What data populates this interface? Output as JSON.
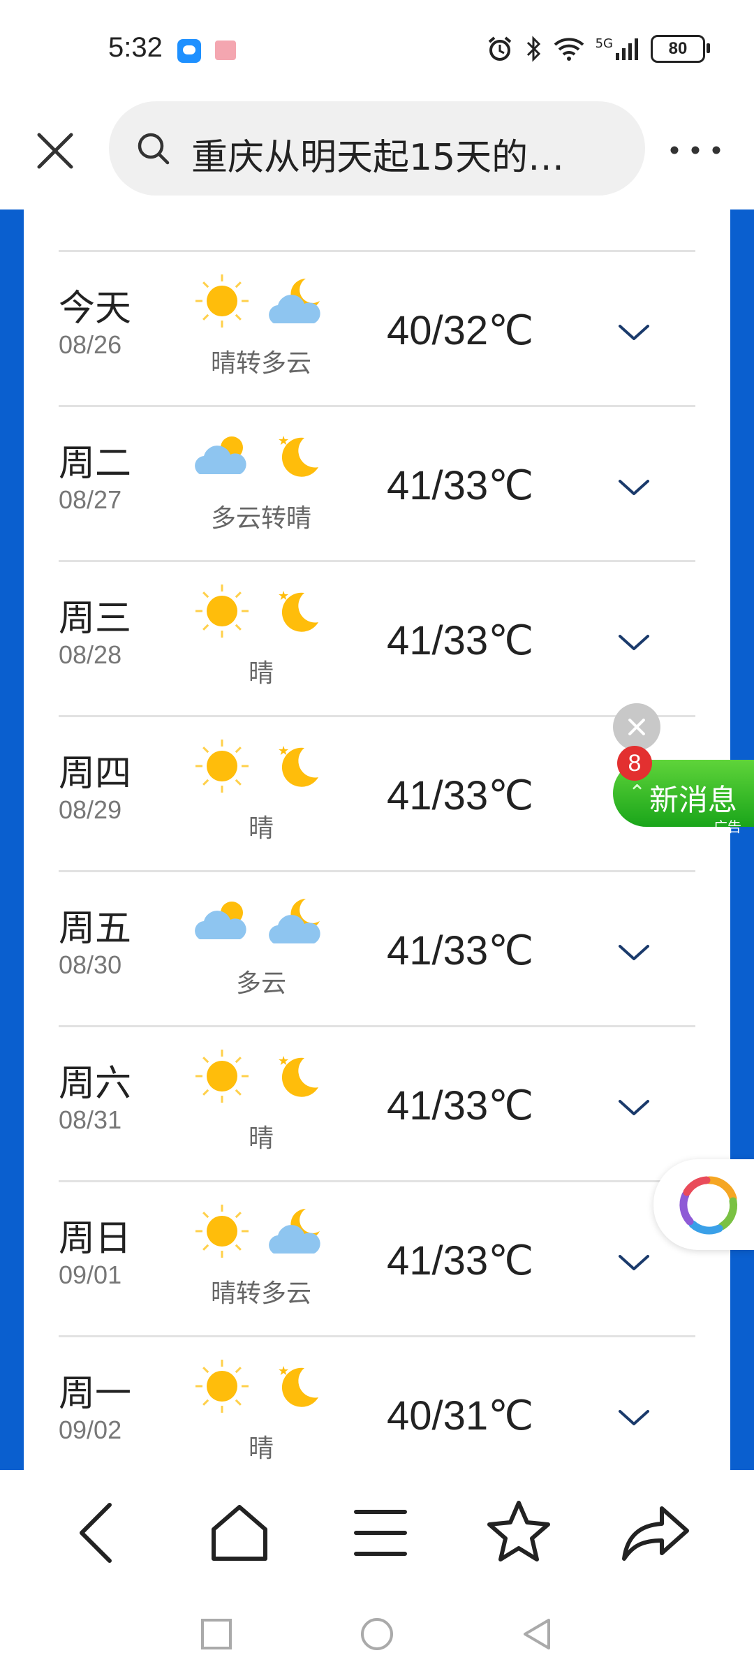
{
  "status_bar": {
    "time": "5:32",
    "network": "5G",
    "battery": "80"
  },
  "topbar": {
    "search_text": "重庆从明天起15天的…"
  },
  "forecast": [
    {
      "day": "今天",
      "date": "08/26",
      "condition": "晴转多云",
      "temp": "40/32℃",
      "icon_day": "sun-icon",
      "icon_night": "moon-cloud-icon"
    },
    {
      "day": "周二",
      "date": "08/27",
      "condition": "多云转晴",
      "temp": "41/33℃",
      "icon_day": "sun-cloud-icon",
      "icon_night": "moon-icon"
    },
    {
      "day": "周三",
      "date": "08/28",
      "condition": "晴",
      "temp": "41/33℃",
      "icon_day": "sun-icon",
      "icon_night": "moon-icon"
    },
    {
      "day": "周四",
      "date": "08/29",
      "condition": "晴",
      "temp": "41/33℃",
      "icon_day": "sun-icon",
      "icon_night": "moon-icon"
    },
    {
      "day": "周五",
      "date": "08/30",
      "condition": "多云",
      "temp": "41/33℃",
      "icon_day": "sun-cloud-icon",
      "icon_night": "moon-cloud-icon"
    },
    {
      "day": "周六",
      "date": "08/31",
      "condition": "晴",
      "temp": "41/33℃",
      "icon_day": "sun-icon",
      "icon_night": "moon-icon"
    },
    {
      "day": "周日",
      "date": "09/01",
      "condition": "晴转多云",
      "temp": "41/33℃",
      "icon_day": "sun-icon",
      "icon_night": "moon-cloud-icon"
    },
    {
      "day": "周一",
      "date": "09/02",
      "condition": "晴",
      "temp": "40/31℃",
      "icon_day": "sun-icon",
      "icon_night": "moon-icon"
    }
  ],
  "ad": {
    "badge_count": "8",
    "label": "新消息",
    "tag": "广告"
  },
  "colors": {
    "page_border_blue": "#0a5fcf",
    "sun": "#ffbd0b",
    "cloud": "#8ec5f0",
    "chevron": "#1a3a6b"
  }
}
